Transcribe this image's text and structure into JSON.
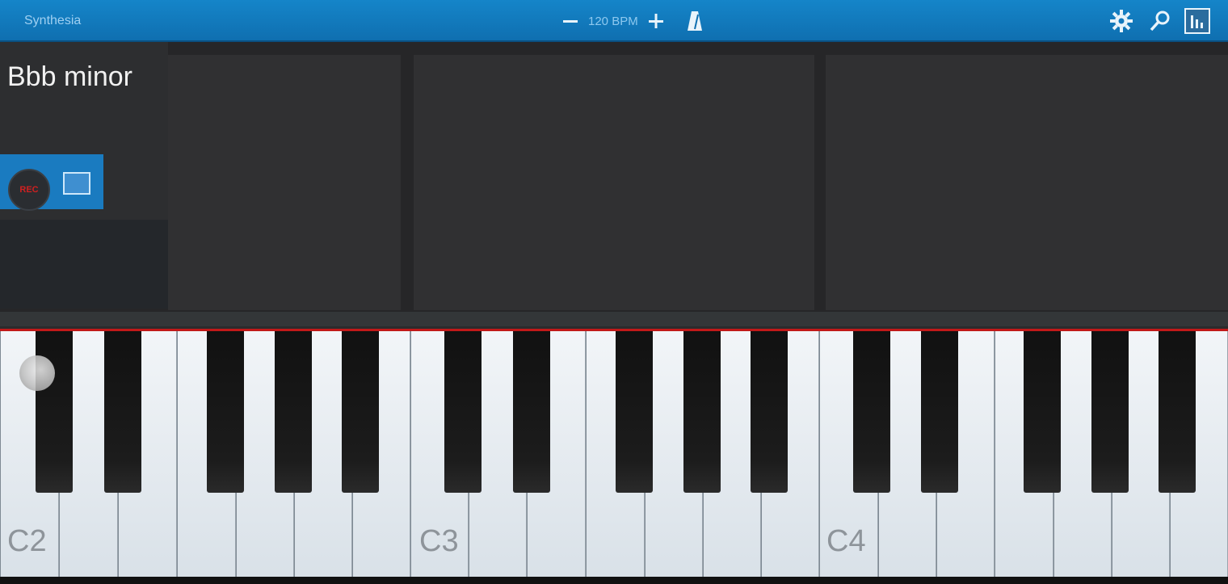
{
  "topbar": {
    "app_title": "Synthesia",
    "tempo_minus": "—",
    "tempo_label": "120 BPM",
    "tempo_plus": "+",
    "accent": "#1585c9"
  },
  "left_panel": {
    "chord_name": "Bbb minor",
    "record_label": "REC"
  },
  "keyboard": {
    "labels": {
      "c2": "C2",
      "c3": "C3",
      "c4": "C4"
    },
    "highlight_color": "#c11919"
  },
  "icons": [
    "minus-icon",
    "plus-icon",
    "metronome-icon",
    "settings-icon",
    "search-icon",
    "chart-icon",
    "record-icon",
    "checkbox-icon"
  ]
}
